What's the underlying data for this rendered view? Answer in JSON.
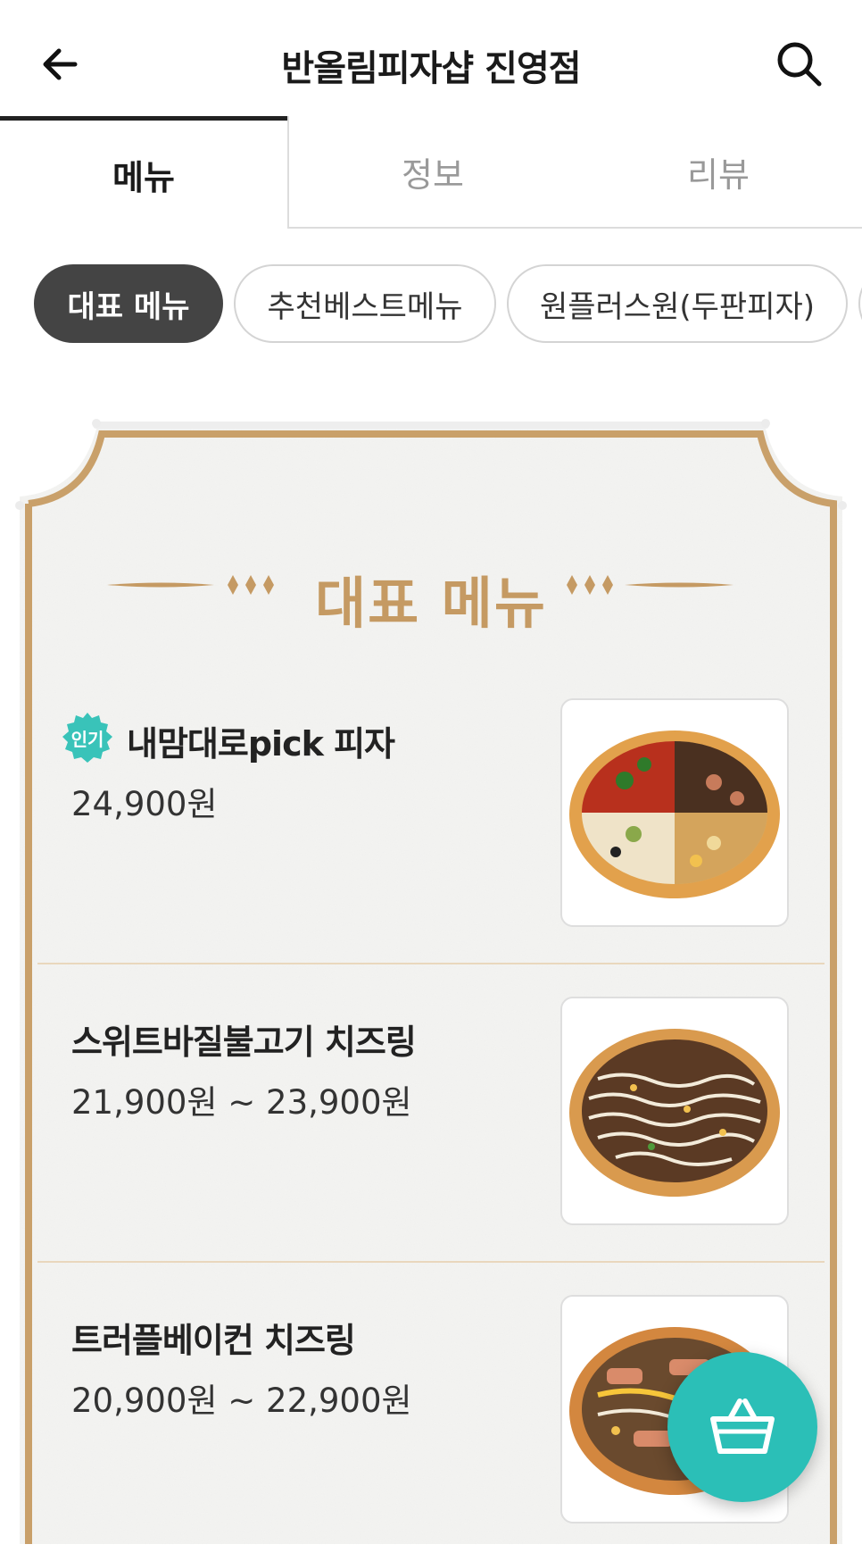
{
  "header": {
    "title": "반올림피자샵 진영점",
    "back_icon": "arrow-left-icon",
    "search_icon": "search-icon"
  },
  "tabs": [
    {
      "label": "메뉴",
      "active": true
    },
    {
      "label": "정보",
      "active": false
    },
    {
      "label": "리뷰",
      "active": false
    }
  ],
  "categories": [
    {
      "label": "대표 메뉴",
      "active": true
    },
    {
      "label": "추천베스트메뉴",
      "active": false
    },
    {
      "label": "원플러스원(두판피자)",
      "active": false
    },
    {
      "label": "",
      "active": false
    }
  ],
  "section": {
    "title": "대표 메뉴"
  },
  "menu_items": [
    {
      "badge": "인기",
      "name": "내맘대로pick 피자",
      "price": "24,900원",
      "image": "pizza-quarter-mix"
    },
    {
      "badge": "",
      "name": "스위트바질불고기 치즈링",
      "price": "21,900원 ~ 23,900원",
      "image": "pizza-bulgogi"
    },
    {
      "badge": "",
      "name": "트러플베이컨 치즈링",
      "price": "20,900원 ~ 22,900원",
      "image": "pizza-truffle-bacon"
    }
  ],
  "cart": {
    "icon": "shopping-basket-icon"
  },
  "colors": {
    "accent": "#2bbfb7",
    "gold": "#c59a63",
    "chip_active": "#444444",
    "badge": "#39c3b9"
  }
}
